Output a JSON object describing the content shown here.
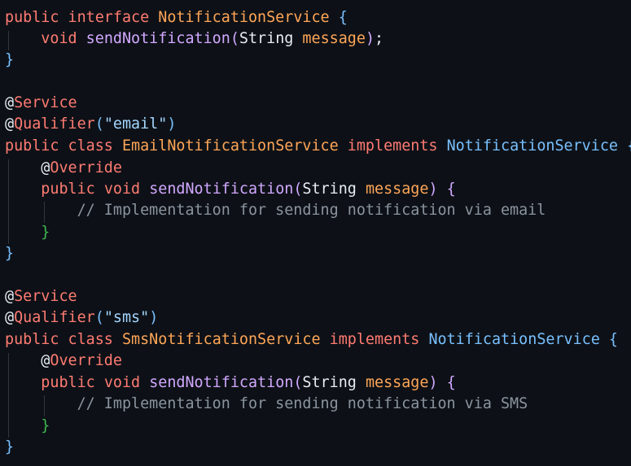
{
  "code": {
    "language": "Java",
    "kw_public": "public",
    "kw_interface": "interface",
    "kw_class": "class",
    "kw_implements": "implements",
    "kw_void": "void",
    "interface_name": "NotificationService",
    "method_name": "sendNotification",
    "param_type": "String",
    "param_name": "message",
    "ann_service": "Service",
    "ann_qualifier": "Qualifier",
    "ann_override": "Override",
    "at": "@",
    "class_email": "EmailNotificationService",
    "class_sms": "SmsNotificationService",
    "str_email": "\"email\"",
    "str_sms": "\"sms\"",
    "comment_email": "// Implementation for sending notification via email",
    "comment_sms": "// Implementation for sending notification via SMS",
    "brace_open": "{",
    "brace_close": "}",
    "paren_open": "(",
    "paren_close": ")",
    "paren_close_semi_paren": ")",
    "semicolon": ";",
    "space": " "
  },
  "colors": {
    "background": "#0d1117",
    "keyword": "#ff7b72",
    "type": "#ffa657",
    "interface": "#79c0ff",
    "function": "#d2a8ff",
    "string": "#a5d6ff",
    "comment": "#8b949e",
    "text": "#e6edf3",
    "bracket_level_1": "#79c0ff",
    "bracket_level_2": "#d2a8ff",
    "bracket_level_3": "#3fb950"
  }
}
